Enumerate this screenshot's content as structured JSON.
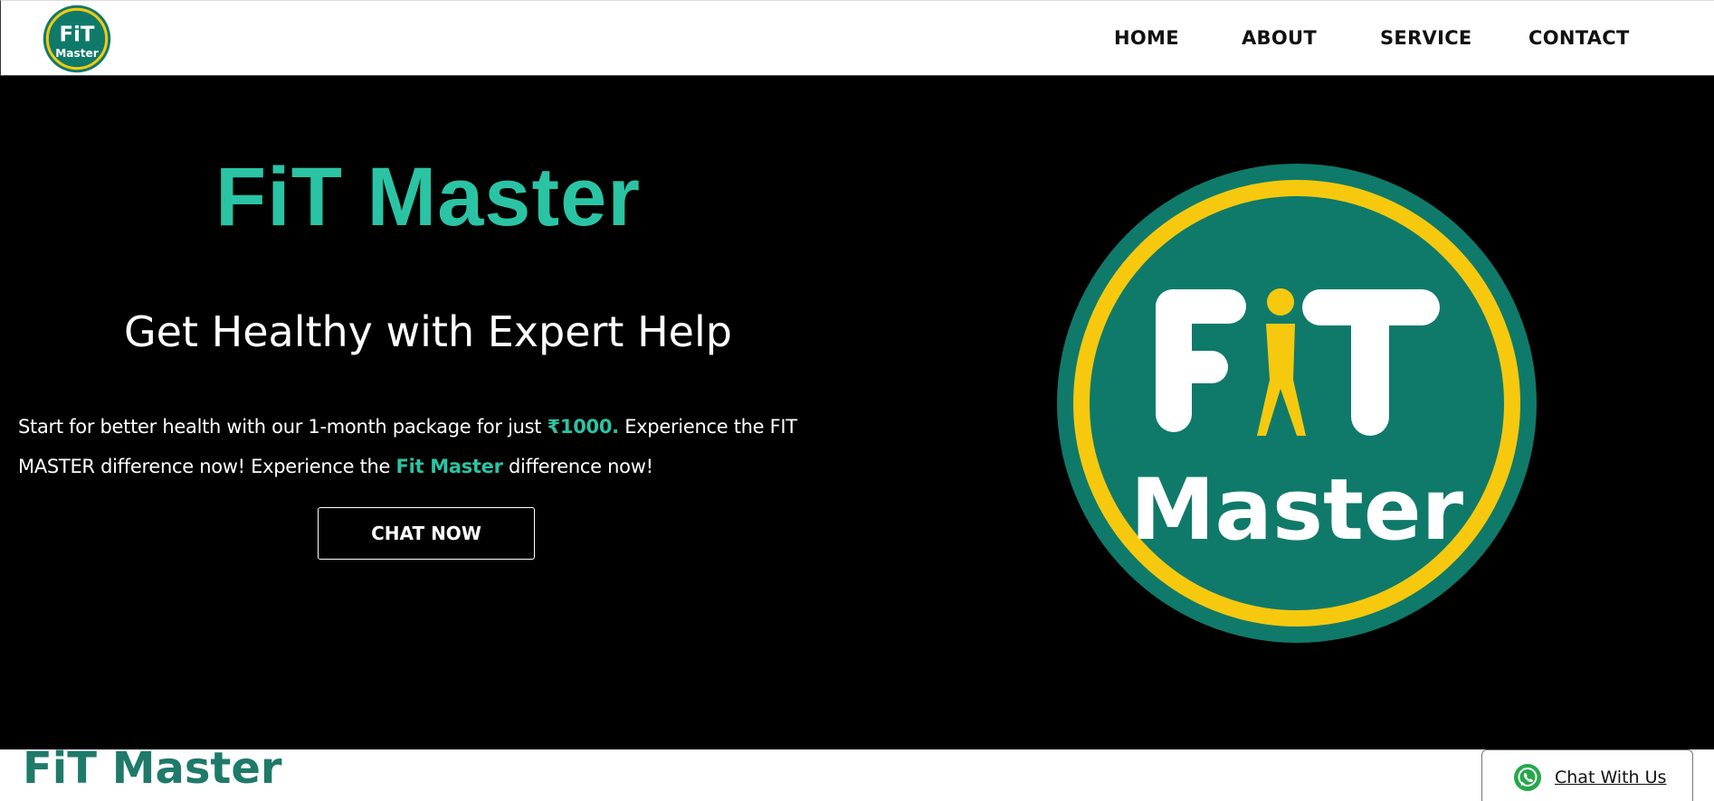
{
  "brand": {
    "logo_line1": "FiT",
    "logo_line2": "Master",
    "colors": {
      "teal_dark": "#0f7a6a",
      "yellow": "#f6c90e",
      "accent": "#2ac4a4"
    }
  },
  "nav": {
    "items": [
      "HOME",
      "ABOUT",
      "SERVICE",
      "CONTACT"
    ]
  },
  "hero": {
    "title": "FiT Master",
    "subtitle": "Get Healthy with Expert Help",
    "desc_part1": "Start for better health with our 1-month package for just ",
    "desc_price": "₹1000.",
    "desc_part2": " Experience the FIT MASTER difference now! Experience the ",
    "desc_brand": "Fit Master",
    "desc_part3": " difference now!",
    "cta_label": "CHAT NOW"
  },
  "footer_strip": {
    "brand": "FiT Master",
    "chat_widget_label": "Chat With Us",
    "chat_widget_icon": "whatsapp-icon"
  }
}
